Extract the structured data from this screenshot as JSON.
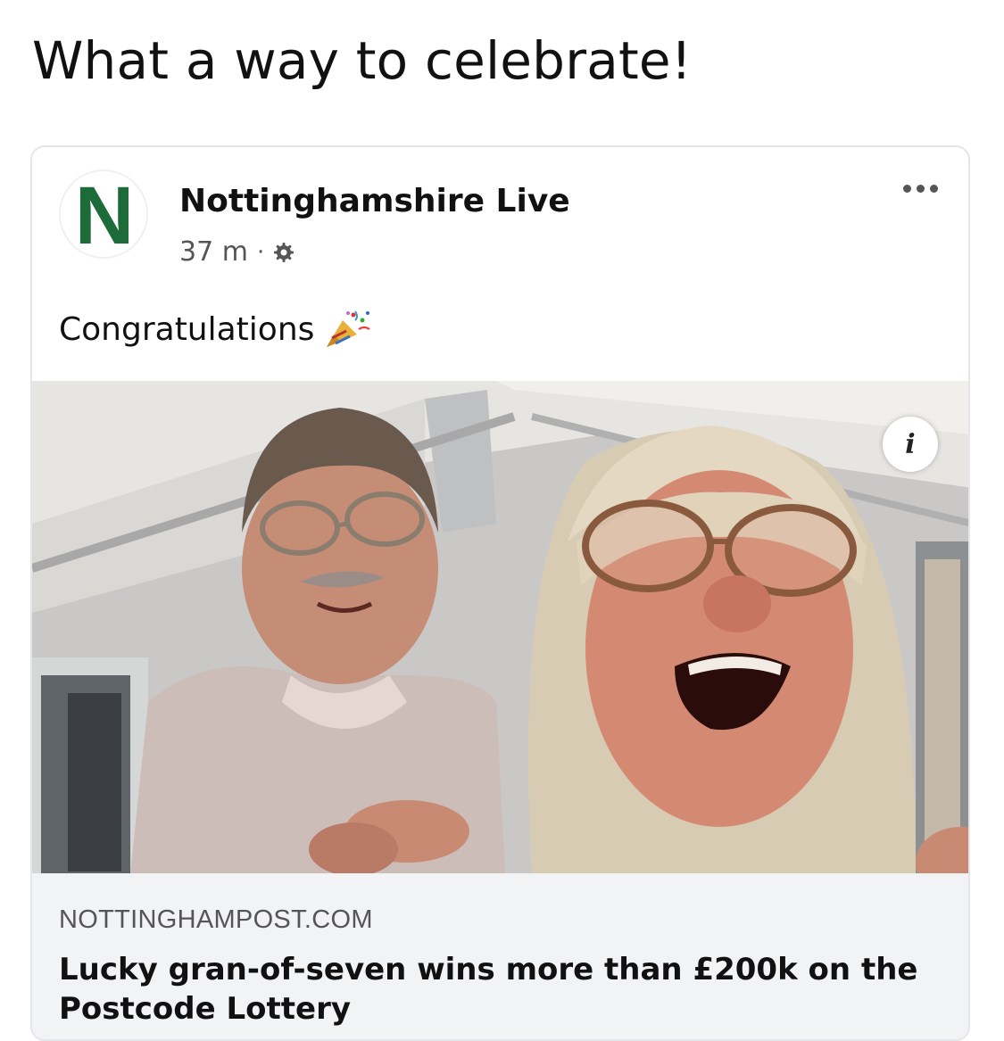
{
  "caption": "What a way to celebrate!",
  "post": {
    "page_name": "Nottinghamshire Live",
    "logo_letter": "N",
    "time": "37 m",
    "meta_separator": "·",
    "privacy_icon": "gear-icon",
    "more_icon": "more-options-icon",
    "text": "Congratulations",
    "emoji": "party-popper-icon"
  },
  "image": {
    "info_label": "i"
  },
  "link": {
    "domain": "NOTTINGHAMPOST.COM",
    "headline": "Lucky gran-of-seven wins more than £200k on the Postcode Lottery"
  },
  "colors": {
    "brand_green": "#1e6b3a",
    "link_bg": "#f2f3f5",
    "card_border": "#e4e6ea"
  }
}
